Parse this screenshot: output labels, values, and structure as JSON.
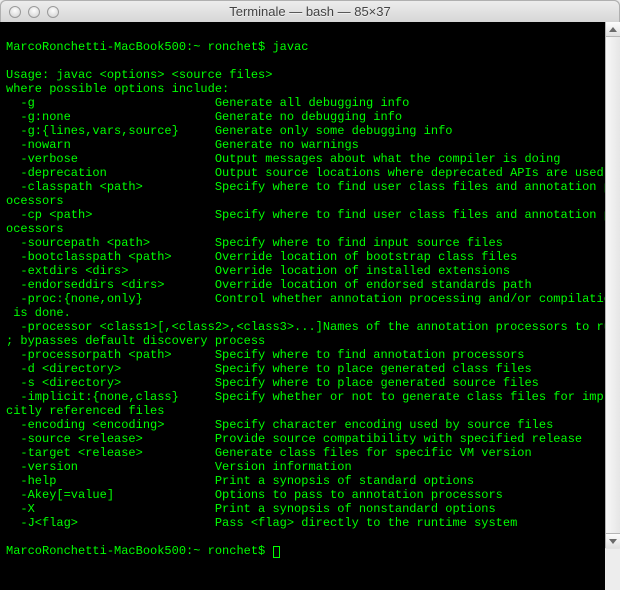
{
  "window": {
    "title": "Terminale — bash — 85×37"
  },
  "prompt1": "MarcoRonchetti-MacBook500:~ ronchet$ javac",
  "prompt2_prefix": "MarcoRonchetti-MacBook500:~ ronchet$ ",
  "lines": [
    "Usage: javac <options> <source files>",
    "where possible options include:",
    "  -g                         Generate all debugging info",
    "  -g:none                    Generate no debugging info",
    "  -g:{lines,vars,source}     Generate only some debugging info",
    "  -nowarn                    Generate no warnings",
    "  -verbose                   Output messages about what the compiler is doing",
    "  -deprecation               Output source locations where deprecated APIs are used",
    "  -classpath <path>          Specify where to find user class files and annotation pr",
    "ocessors",
    "  -cp <path>                 Specify where to find user class files and annotation pr",
    "ocessors",
    "  -sourcepath <path>         Specify where to find input source files",
    "  -bootclasspath <path>      Override location of bootstrap class files",
    "  -extdirs <dirs>            Override location of installed extensions",
    "  -endorseddirs <dirs>       Override location of endorsed standards path",
    "  -proc:{none,only}          Control whether annotation processing and/or compilation",
    " is done.",
    "  -processor <class1>[,<class2>,<class3>...]Names of the annotation processors to run",
    "; bypasses default discovery process",
    "  -processorpath <path>      Specify where to find annotation processors",
    "  -d <directory>             Specify where to place generated class files",
    "  -s <directory>             Specify where to place generated source files",
    "  -implicit:{none,class}     Specify whether or not to generate class files for impli",
    "citly referenced files",
    "  -encoding <encoding>       Specify character encoding used by source files",
    "  -source <release>          Provide source compatibility with specified release",
    "  -target <release>          Generate class files for specific VM version",
    "  -version                   Version information",
    "  -help                      Print a synopsis of standard options",
    "  -Akey[=value]              Options to pass to annotation processors",
    "  -X                         Print a synopsis of nonstandard options",
    "  -J<flag>                   Pass <flag> directly to the runtime system",
    ""
  ]
}
